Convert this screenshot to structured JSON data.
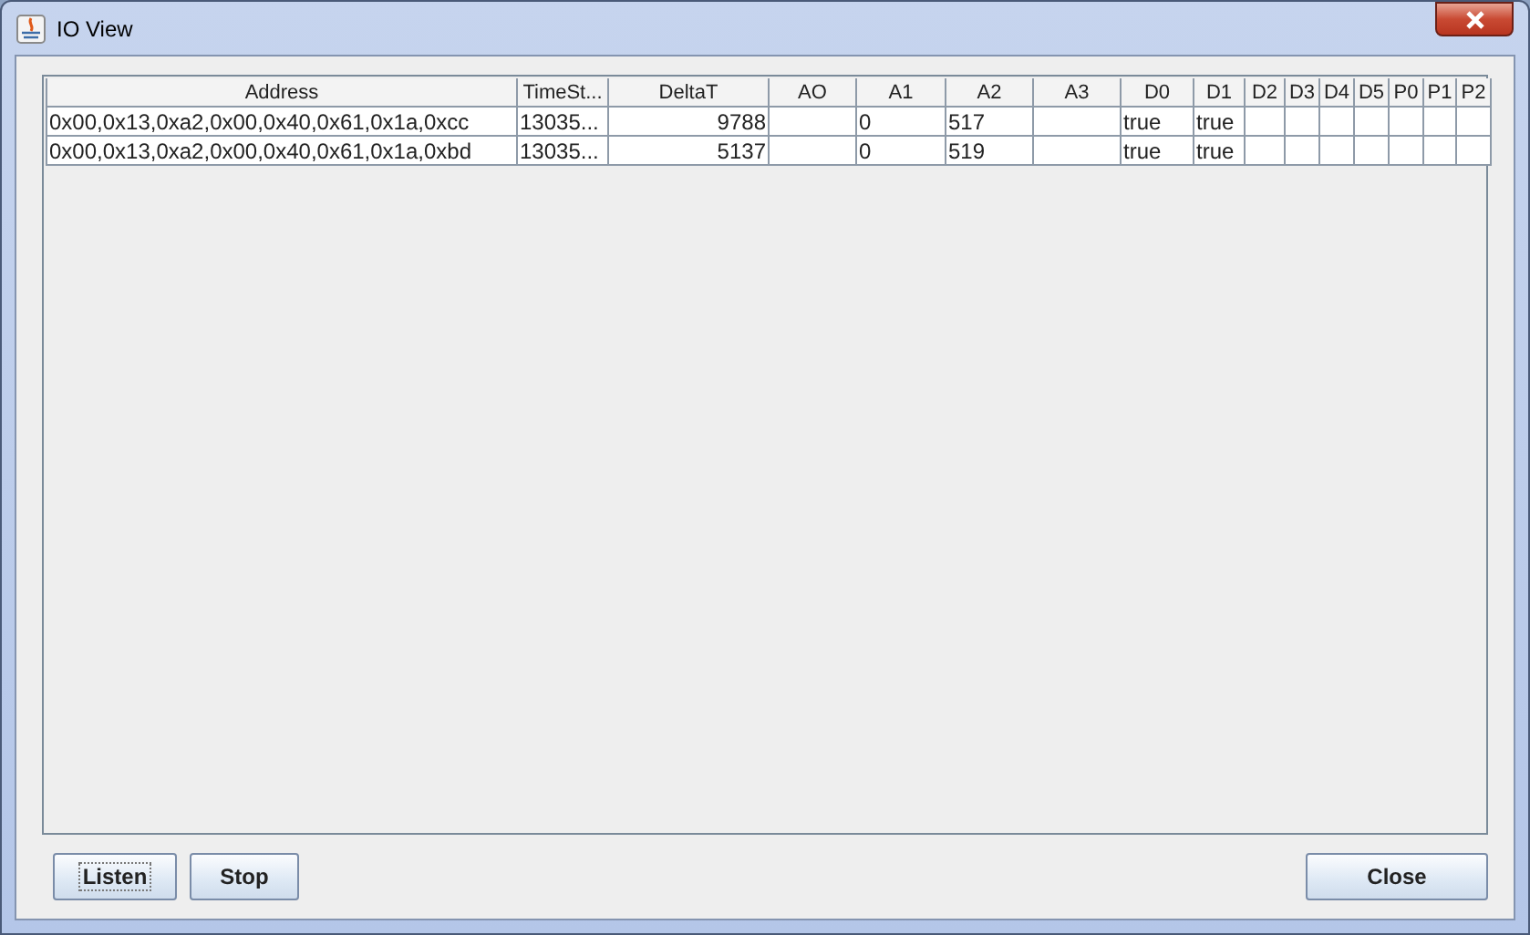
{
  "window": {
    "title": "IO View"
  },
  "table": {
    "columns": [
      {
        "label": "Address",
        "kind": "text"
      },
      {
        "label": "TimeSt...",
        "kind": "text"
      },
      {
        "label": "DeltaT",
        "kind": "number"
      },
      {
        "label": "AO",
        "kind": "text"
      },
      {
        "label": "A1",
        "kind": "text"
      },
      {
        "label": "A2",
        "kind": "text"
      },
      {
        "label": "A3",
        "kind": "text"
      },
      {
        "label": "D0",
        "kind": "text"
      },
      {
        "label": "D1",
        "kind": "text"
      },
      {
        "label": "D2",
        "kind": "text"
      },
      {
        "label": "D3",
        "kind": "text"
      },
      {
        "label": "D4",
        "kind": "text"
      },
      {
        "label": "D5",
        "kind": "text"
      },
      {
        "label": "P0",
        "kind": "text"
      },
      {
        "label": "P1",
        "kind": "text"
      },
      {
        "label": "P2",
        "kind": "text"
      }
    ],
    "rows": [
      [
        "0x00,0x13,0xa2,0x00,0x40,0x61,0x1a,0xcc",
        "13035...",
        "9788",
        null,
        "0",
        "517",
        null,
        "true",
        "true",
        null,
        null,
        null,
        null,
        null,
        null,
        null
      ],
      [
        "0x00,0x13,0xa2,0x00,0x40,0x61,0x1a,0xbd",
        "13035...",
        "5137",
        null,
        "0",
        "519",
        null,
        "true",
        "true",
        null,
        null,
        null,
        null,
        null,
        null,
        null
      ]
    ]
  },
  "buttons": [
    {
      "label": "Listen",
      "focused": true
    },
    {
      "label": "Stop",
      "focused": false
    }
  ],
  "close_button": {
    "label": "Close",
    "focused": false
  }
}
